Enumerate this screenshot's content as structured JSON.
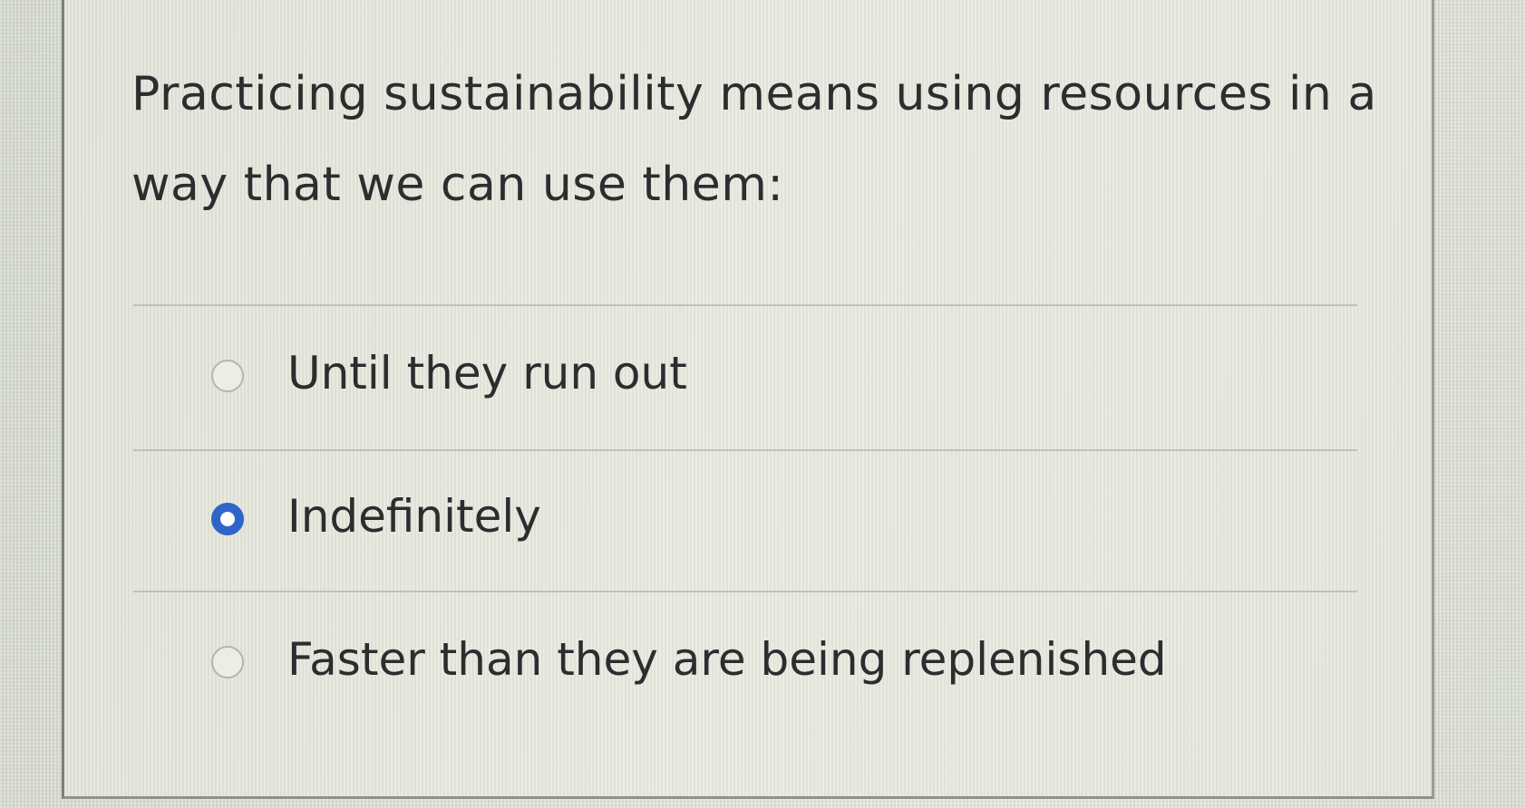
{
  "question": {
    "text": "Practicing sustainability means using resources in a way that we can use them:"
  },
  "answers": [
    {
      "label": "Until they run out",
      "selected": false
    },
    {
      "label": "Indefinitely",
      "selected": true
    },
    {
      "label": "Faster than they are being replenished",
      "selected": false
    }
  ],
  "colors": {
    "radio_selected": "#2f64c9",
    "text": "#2b2d2e"
  }
}
